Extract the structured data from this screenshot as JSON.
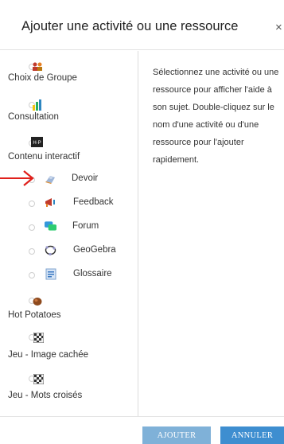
{
  "dialog": {
    "title": "Ajouter une activité ou une ressource",
    "close_label": "×"
  },
  "activities": [
    {
      "label": "Choix de Groupe",
      "icon": "group-choice-icon"
    },
    {
      "label": "Consultation",
      "icon": "bar-chart-icon"
    },
    {
      "label": "Contenu interactif",
      "icon": "h5p-icon"
    },
    {
      "label": "Devoir",
      "icon": "assignment-icon"
    },
    {
      "label": "Feedback",
      "icon": "megaphone-icon"
    },
    {
      "label": "Forum",
      "icon": "forum-icon"
    },
    {
      "label": "GeoGebra",
      "icon": "geogebra-icon"
    },
    {
      "label": "Glossaire",
      "icon": "glossary-icon"
    },
    {
      "label": "Hot Potatoes",
      "icon": "hot-potatoes-icon"
    },
    {
      "label": "Jeu - Image cachée",
      "icon": "puzzle-grid-icon"
    },
    {
      "label": "Jeu - Mots croisés",
      "icon": "crossword-grid-icon"
    }
  ],
  "help_text": "Sélectionnez une activité ou une ressource pour afficher l'aide à son sujet. Double-cliquez sur le nom d'une activité ou d'une ressource pour l'ajouter rapidement.",
  "footer": {
    "add_label": "AJOUTER",
    "cancel_label": "ANNULER"
  },
  "colors": {
    "add_button": "#7fb1d8",
    "cancel_button": "#3e8ed0",
    "annotation_arrow": "#e0201b"
  }
}
